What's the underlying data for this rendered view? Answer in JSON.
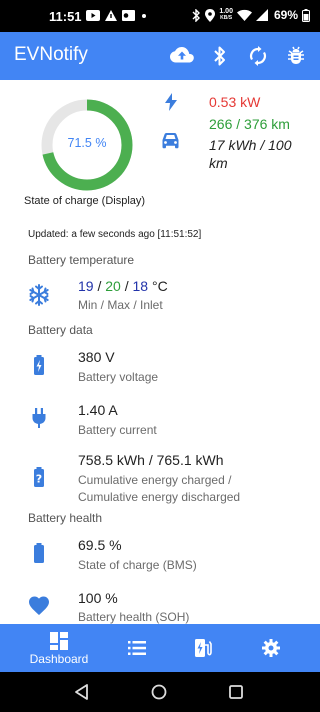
{
  "status_bar": {
    "time": "11:51",
    "net_speed_top": "1.00",
    "net_speed_bottom": "KB/S",
    "battery_percent": "69%"
  },
  "app_bar": {
    "title": "EVNotify",
    "actions": [
      "cloud-upload-icon",
      "bluetooth-icon",
      "sync-icon",
      "bug-icon"
    ]
  },
  "soc_gauge": {
    "value_label": "71.5 %",
    "fraction": 0.715,
    "caption": "State of charge (Display)",
    "fill_color": "#4caf50",
    "track_color": "#e6e6e6"
  },
  "realtime": {
    "power": "0.53 kW",
    "range": "266 / 376 km",
    "consumption": "17 kWh / 100 km",
    "power_color": "#e53935",
    "range_color": "#2e9e3a"
  },
  "updated": "Updated: a few seconds ago [11:51:52]",
  "battery_temperature": {
    "heading": "Battery temperature",
    "min": "19",
    "max": "20",
    "inlet": "18",
    "separator": "/",
    "unit": "°C",
    "label": "Min / Max / Inlet"
  },
  "battery_data": {
    "heading": "Battery data",
    "voltage": {
      "value": "380 V",
      "label": "Battery voltage"
    },
    "current": {
      "value": "1.40 A",
      "label": "Battery current"
    },
    "energy": {
      "value": "758.5 kWh / 765.1 kWh",
      "label_line1": "Cumulative energy charged /",
      "label_line2": "Cumulative energy discharged"
    }
  },
  "battery_health": {
    "heading": "Battery health",
    "soc_bms": {
      "value": "69.5 %",
      "label": "State of charge (BMS)"
    },
    "soh": {
      "value": "100 %",
      "label": "Battery health (SOH)"
    }
  },
  "bottom_nav": {
    "dashboard_label": "Dashboard",
    "items": [
      "dashboard-icon",
      "list-icon",
      "charging-station-icon",
      "settings-icon"
    ]
  },
  "colors": {
    "primary": "#4285f4",
    "icon_blue": "#3b7ddd"
  }
}
